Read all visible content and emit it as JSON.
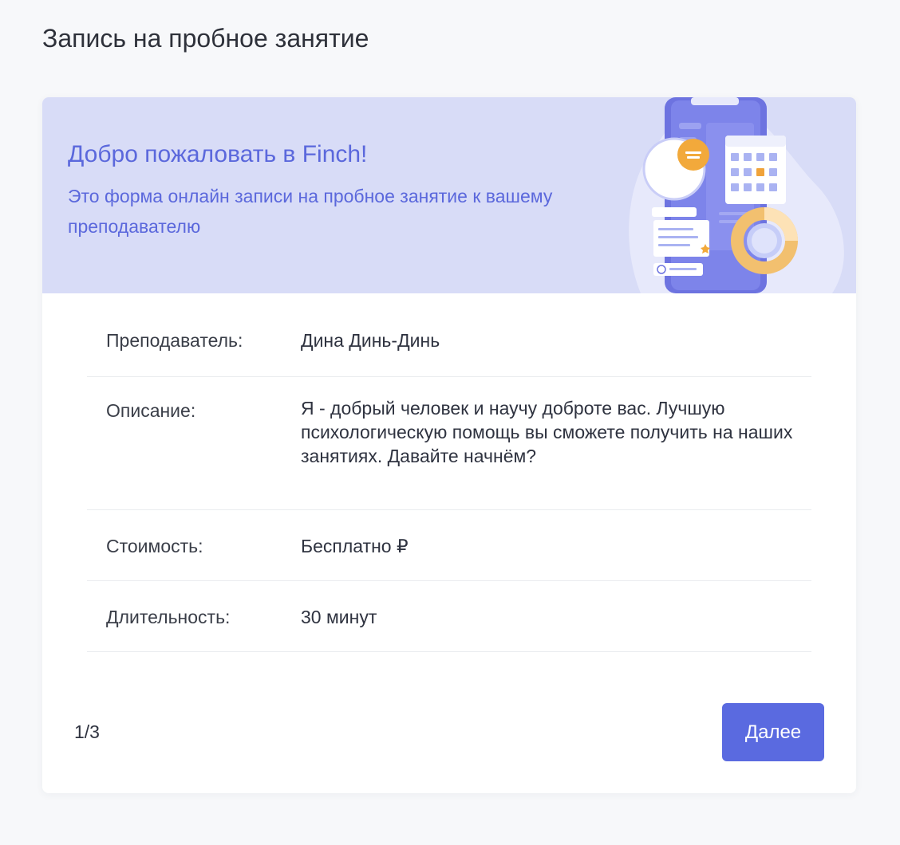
{
  "page": {
    "title": "Запись на пробное занятие"
  },
  "banner": {
    "title": "Добро пожаловать в Finch!",
    "text": "Это форма онлайн записи на пробное занятие к вашему преподавателю"
  },
  "details": {
    "teacher_label": "Преподаватель:",
    "teacher_value": "Дина Динь-Динь",
    "description_label": "Описание:",
    "description_value": "Я - добрый человек и научу доброте вас.  Лучшую психологическую помощь вы сможете получить на наших занятиях. Давайте начнём?",
    "price_label": "Стоимость:",
    "price_value": "Бесплатно ₽",
    "duration_label": "Длительность:",
    "duration_value": "30 минут"
  },
  "footer": {
    "step": "1/3",
    "next_label": "Далее"
  },
  "colors": {
    "accent": "#5a6ae0",
    "banner_background": "#d8dcf7",
    "banner_text": "#5b68dc",
    "page_background": "#f7f8fa"
  },
  "icons": {
    "illustration": "phone-calendar-illustration"
  }
}
